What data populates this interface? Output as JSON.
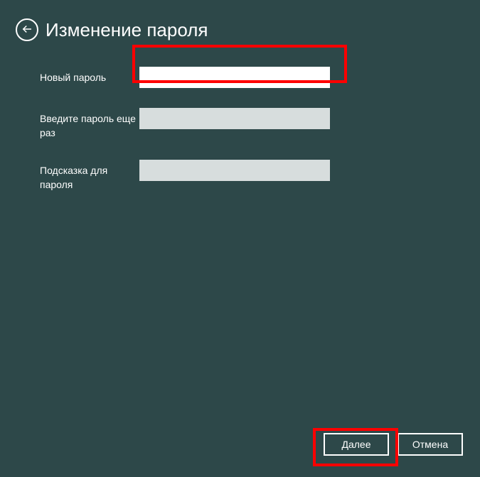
{
  "header": {
    "title": "Изменение пароля"
  },
  "fields": {
    "newPassword": {
      "label": "Новый пароль",
      "value": ""
    },
    "confirmPassword": {
      "label": "Введите пароль еще раз",
      "value": ""
    },
    "hint": {
      "label": "Подсказка для пароля",
      "value": ""
    }
  },
  "buttons": {
    "next": "Далее",
    "cancel": "Отмена"
  }
}
